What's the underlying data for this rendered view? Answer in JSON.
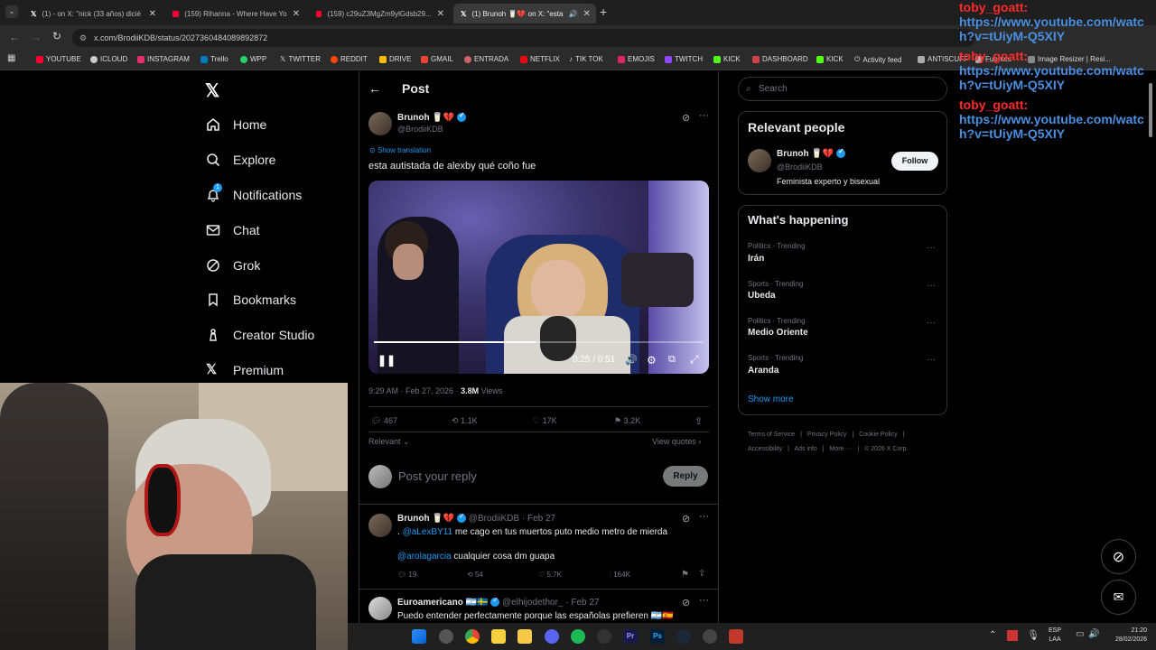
{
  "browser": {
    "tabs": [
      {
        "title": "(1) - on X: \"nick (33 años) dicié"
      },
      {
        "title": "(159) Rihanna - Where Have Yo"
      },
      {
        "title": "(159) c29uZ3MgZm9ylGdsb29..."
      },
      {
        "title": "(1) Brunoh 🥛💔 on X: \"esta"
      }
    ],
    "url": "x.com/BrodiiKDB/status/2027360484089892872",
    "bookmarks": [
      "YOUTUBE",
      "ICLOUD",
      "INSTAGRAM",
      "Trello",
      "WPP",
      "TWITTER",
      "REDDIT",
      "DRIVE",
      "GMAIL",
      "ENTRADA",
      "NETFLIX",
      "TIK TOK",
      "EMOJIS",
      "TWITCH",
      "KICK",
      "DASHBOARD",
      "KICK",
      "Activity feed",
      "ANTISCUFF",
      "Fuentes",
      "Image Resizer | Resi..."
    ]
  },
  "nav": {
    "items": [
      "Home",
      "Explore",
      "Notifications",
      "Chat",
      "Grok",
      "Bookmarks",
      "Creator Studio",
      "Premium"
    ],
    "notification_badge": "1"
  },
  "post": {
    "header_title": "Post",
    "author_name": "Brunoh 🥛💔",
    "author_handle": "@BrodiiKDB",
    "show_translation": "Show translation",
    "text": "esta autistada de alexby qué coño fue",
    "video_time": "0:25 / 0:51",
    "video_progress": 0.49,
    "timestamp": "9:29 AM · Feb 27, 2026 · ",
    "views": "3.8M",
    "views_label": " Views",
    "stats": {
      "replies": "467",
      "reposts": "1.1K",
      "likes": "17K",
      "bookmarks": "3.2K"
    },
    "sort_label": "Relevant",
    "view_quotes": "View quotes",
    "reply_placeholder": "Post your reply",
    "reply_button": "Reply"
  },
  "replies": [
    {
      "name": "Brunoh 🥛💔",
      "handle": "@BrodiiKDB · Feb 27",
      "line1_prefix": ". ",
      "line1_mention": "@aLexBY11",
      "line1_text": " me cago en tus muertos puto medio metro de mierda",
      "line2_mention": "@arolagarcia",
      "line2_text": " cualquier cosa dm guapa",
      "stats": {
        "replies": "19",
        "reposts": "54",
        "likes": "5.7K",
        "views": "164K"
      }
    },
    {
      "name": "Euroamericano 🇦🇷🇸🇪",
      "handle": "@elhijodethor_ · Feb 27",
      "text": "Puedo entender perfectamente porque las españolas prefieren 🇦🇷🇪🇸"
    }
  ],
  "sidebar": {
    "search_placeholder": "Search",
    "relevant_people_title": "Relevant people",
    "person": {
      "name": "Brunoh 🥛💔",
      "handle": "@BrodiiKDB",
      "bio": "Feminista experto y bisexual",
      "follow": "Follow"
    },
    "happening_title": "What's happening",
    "trends": [
      {
        "category": "Politics · Trending",
        "name": "Irán"
      },
      {
        "category": "Sports · Trending",
        "name": "Ubeda"
      },
      {
        "category": "Politics · Trending",
        "name": "Medio Oriente"
      },
      {
        "category": "Sports · Trending",
        "name": "Aranda"
      }
    ],
    "show_more": "Show more",
    "footer": [
      "Terms of Service",
      "Privacy Policy",
      "Cookie Policy",
      "Accessibility",
      "Ads info",
      "More ···",
      "© 2026 X Corp."
    ]
  },
  "chat_overlay": {
    "messages": [
      {
        "user": "toby_goatt:",
        "text": "https://www.youtube.com/watch?v=tUiyM-Q5XIY"
      },
      {
        "user": "toby_goatt:",
        "text": "https://www.youtube.com/watch?v=tUiyM-Q5XIY"
      },
      {
        "user": "toby_goatt:",
        "text": "https://www.youtube.com/watch?v=tUiyM-Q5XIY"
      }
    ]
  },
  "taskbar": {
    "lang": "ESP",
    "lang_sub": "LAA",
    "time": "21:20",
    "date": "28/02/2026"
  },
  "colors": {
    "accent": "#1d9bf0",
    "chat_user": "#ff2a2a",
    "chat_link": "#4a90e2"
  }
}
